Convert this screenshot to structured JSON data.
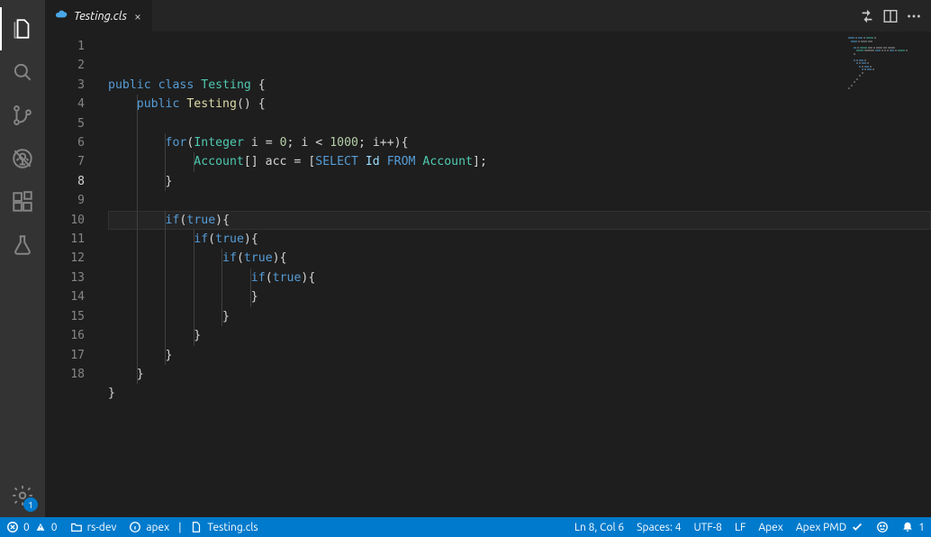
{
  "tab": {
    "filename": "Testing.cls"
  },
  "settings_badge": "1",
  "code": {
    "current_line": 8,
    "lines": [
      {
        "n": 1,
        "indent": 0,
        "tokens": [
          [
            "kw",
            "public"
          ],
          [
            "plain",
            " "
          ],
          [
            "kw",
            "class"
          ],
          [
            "plain",
            " "
          ],
          [
            "type",
            "Testing"
          ],
          [
            "plain",
            " {"
          ]
        ]
      },
      {
        "n": 2,
        "indent": 1,
        "tokens": [
          [
            "kw",
            "public"
          ],
          [
            "plain",
            " "
          ],
          [
            "fn",
            "Testing"
          ],
          [
            "plain",
            "() {"
          ]
        ]
      },
      {
        "n": 3,
        "indent": 1,
        "tokens": []
      },
      {
        "n": 4,
        "indent": 2,
        "tokens": [
          [
            "kw",
            "for"
          ],
          [
            "plain",
            "("
          ],
          [
            "type",
            "Integer"
          ],
          [
            "plain",
            " i = "
          ],
          [
            "num",
            "0"
          ],
          [
            "plain",
            "; i < "
          ],
          [
            "num",
            "1000"
          ],
          [
            "plain",
            "; i++){"
          ]
        ]
      },
      {
        "n": 5,
        "indent": 3,
        "tokens": [
          [
            "type",
            "Account"
          ],
          [
            "plain",
            "[] acc = ["
          ],
          [
            "kw",
            "SELECT"
          ],
          [
            "plain",
            " "
          ],
          [
            "str",
            "Id"
          ],
          [
            "plain",
            " "
          ],
          [
            "kw",
            "FROM"
          ],
          [
            "plain",
            " "
          ],
          [
            "type",
            "Account"
          ],
          [
            "plain",
            "];"
          ]
        ]
      },
      {
        "n": 6,
        "indent": 2,
        "tokens": [
          [
            "plain",
            "}"
          ]
        ]
      },
      {
        "n": 7,
        "indent": 1,
        "tokens": []
      },
      {
        "n": 8,
        "indent": 2,
        "tokens": [
          [
            "kw",
            "if"
          ],
          [
            "plain",
            "("
          ],
          [
            "kw",
            "true"
          ],
          [
            "plain",
            "){"
          ]
        ]
      },
      {
        "n": 9,
        "indent": 3,
        "tokens": [
          [
            "kw",
            "if"
          ],
          [
            "plain",
            "("
          ],
          [
            "kw",
            "true"
          ],
          [
            "plain",
            "){"
          ]
        ]
      },
      {
        "n": 10,
        "indent": 4,
        "tokens": [
          [
            "kw",
            "if"
          ],
          [
            "plain",
            "("
          ],
          [
            "kw",
            "true"
          ],
          [
            "plain",
            "){"
          ]
        ]
      },
      {
        "n": 11,
        "indent": 5,
        "tokens": [
          [
            "kw",
            "if"
          ],
          [
            "plain",
            "("
          ],
          [
            "kw",
            "true"
          ],
          [
            "plain",
            "){"
          ]
        ]
      },
      {
        "n": 12,
        "indent": 5,
        "tokens": [
          [
            "plain",
            "}"
          ]
        ]
      },
      {
        "n": 13,
        "indent": 4,
        "tokens": [
          [
            "plain",
            "}"
          ]
        ]
      },
      {
        "n": 14,
        "indent": 3,
        "tokens": [
          [
            "plain",
            "}"
          ]
        ]
      },
      {
        "n": 15,
        "indent": 2,
        "tokens": [
          [
            "plain",
            "}"
          ]
        ]
      },
      {
        "n": 16,
        "indent": 1,
        "tokens": [
          [
            "plain",
            "}"
          ]
        ]
      },
      {
        "n": 17,
        "indent": 0,
        "tokens": [
          [
            "plain",
            "}"
          ]
        ]
      },
      {
        "n": 18,
        "indent": 0,
        "tokens": []
      }
    ]
  },
  "statusbar": {
    "errors": "0",
    "warnings": "0",
    "branch": "rs-dev",
    "lang_status": "apex",
    "file_status": "Testing.cls",
    "cursor": "Ln 8, Col 6",
    "spaces": "Spaces: 4",
    "encoding": "UTF-8",
    "eol": "LF",
    "language": "Apex",
    "pmd": "Apex PMD",
    "notifications": "1"
  }
}
